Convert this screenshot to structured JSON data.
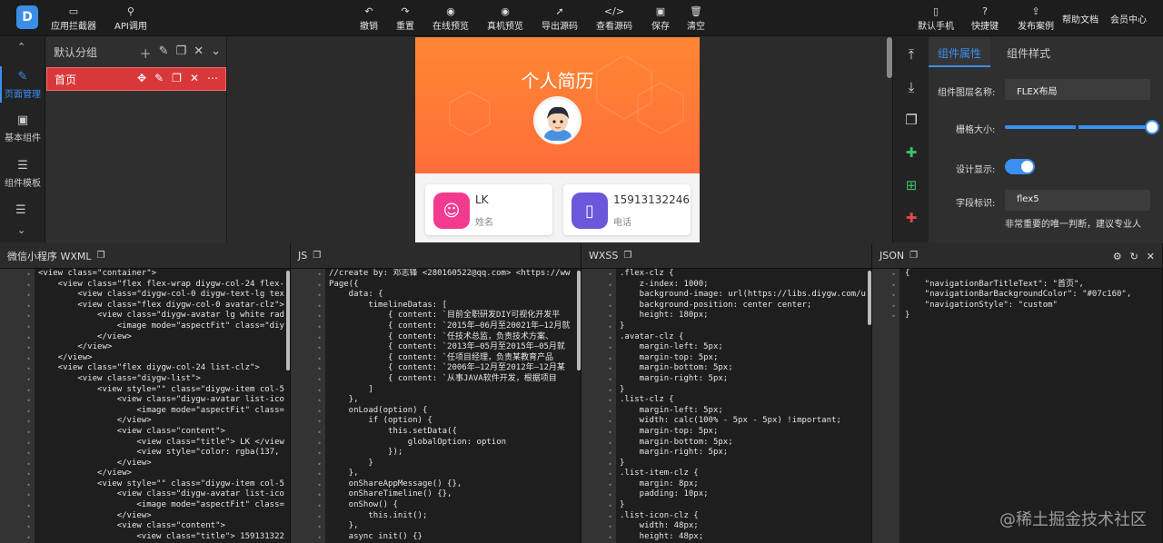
{
  "toolbar": {
    "left": [
      {
        "icon": "app-interceptor-icon",
        "label": "应用拦截器"
      },
      {
        "icon": "api-icon",
        "label": "API调用"
      }
    ],
    "center": [
      {
        "icon": "undo-icon",
        "label": "撤销"
      },
      {
        "icon": "redo-icon",
        "label": "重置"
      },
      {
        "icon": "eye-icon",
        "label": "在线预览"
      },
      {
        "icon": "eye-icon",
        "label": "真机预览"
      },
      {
        "icon": "export-icon",
        "label": "导出源码"
      },
      {
        "icon": "code-icon",
        "label": "查看源码"
      },
      {
        "icon": "save-icon",
        "label": "保存"
      },
      {
        "icon": "trash-icon",
        "label": "清空"
      }
    ],
    "right": [
      {
        "icon": "phone-icon",
        "label": "默认手机"
      },
      {
        "icon": "question-icon",
        "label": "快捷键"
      },
      {
        "icon": "publish-icon",
        "label": "发布案例"
      },
      {
        "icon": "",
        "label": "帮助文档"
      },
      {
        "icon": "",
        "label": "会员中心"
      }
    ]
  },
  "leftnav": [
    {
      "icon": "pen-icon",
      "label": "页面管理",
      "active": true
    },
    {
      "icon": "component-icon",
      "label": "基本组件",
      "active": false
    },
    {
      "icon": "database-icon",
      "label": "组件模板",
      "active": false
    }
  ],
  "pages": {
    "group": "默认分组",
    "items": [
      {
        "label": "首页"
      }
    ]
  },
  "preview": {
    "title": "个人简历",
    "cards": [
      {
        "value": "LK",
        "label": "姓名",
        "color": "#f33a8f"
      },
      {
        "value": "15913132246",
        "label": "电话",
        "color": "#6a57d9"
      }
    ]
  },
  "props": {
    "tabs": [
      "组件属性",
      "组件样式"
    ],
    "layer_name_label": "组件图层名称:",
    "layer_name_value": "FLEX布局",
    "grid_size_label": "栅格大小:",
    "design_show_label": "设计显示:",
    "field_id_label": "字段标识:",
    "field_id_value": "flex5",
    "hint": "非常重要的唯一判断，建议专业人"
  },
  "panels": {
    "wxml": {
      "title": "微信小程序 WXML",
      "lines": [
        "<view class=\"container\">",
        "    <view class=\"flex flex-wrap diygw-col-24 flex-",
        "        <view class=\"diygw-col-0 diygw-text-lg tex",
        "        <view class=\"flex diygw-col-0 avatar-clz\">",
        "            <view class=\"diygw-avatar lg white rad",
        "                <image mode=\"aspectFit\" class=\"diy",
        "            </view>",
        "        </view>",
        "    </view>",
        "    <view class=\"flex diygw-col-24 list-clz\">",
        "        <view class=\"diygw-list\">",
        "            <view style=\"\" class=\"diygw-item col-5",
        "                <view class=\"diygw-avatar list-ico",
        "                    <image mode=\"aspectFit\" class=",
        "                </view>",
        "                <view class=\"content\">",
        "                    <view class=\"title\"> LK </view",
        "                    <view style=\"color: rgba(137,",
        "                </view>",
        "            </view>",
        "            <view style=\"\" class=\"diygw-item col-5",
        "                <view class=\"diygw-avatar list-ico",
        "                    <image mode=\"aspectFit\" class=",
        "                </view>",
        "                <view class=\"content\">",
        "                    <view class=\"title\"> 159131322"
      ]
    },
    "js": {
      "title": "JS",
      "lines": [
        "//create by: 邓志锋 <280160522@qq.com> <https://ww",
        "Page({",
        "    data: {",
        "        timelineDatas: [",
        "            { content: `目前全职研发DIY可视化开发平",
        "            { content: `2015年—06月至20021年—12月就",
        "            { content: `任技术总监，负责技术方案、",
        "            { content: `2013年—05月至2015年—05月就",
        "            { content: `任项目经理，负责某教育产品",
        "            { content: `2006年—12月至2012年—12月某",
        "            { content: `从事JAVA软件开发，根据项目",
        "        ]",
        "    },",
        "    onLoad(option) {",
        "        if (option) {",
        "            this.setData({",
        "                globalOption: option",
        "            });",
        "        }",
        "    },",
        "    onShareAppMessage() {},",
        "    onShareTimeline() {},",
        "    onShow() {",
        "        this.init();",
        "    },",
        "    async init() {}"
      ]
    },
    "wxss": {
      "title": "WXSS",
      "lines": [
        ".flex-clz {",
        "    z-index: 1000;",
        "    background-image: url(https://libs.diygw.com/u",
        "    background-position: center center;",
        "    height: 180px;",
        "}",
        ".avatar-clz {",
        "    margin-left: 5px;",
        "    margin-top: 5px;",
        "    margin-bottom: 5px;",
        "    margin-right: 5px;",
        "}",
        ".list-clz {",
        "    margin-left: 5px;",
        "    width: calc(100% - 5px - 5px) !important;",
        "    margin-top: 5px;",
        "    margin-bottom: 5px;",
        "    margin-right: 5px;",
        "}",
        ".list-item-clz {",
        "    margin: 8px;",
        "    padding: 10px;",
        "}",
        ".list-icon-clz {",
        "    width: 48px;",
        "    height: 48px;"
      ]
    },
    "json": {
      "title": "JSON",
      "lines": [
        "{",
        "    \"navigationBarTitleText\": \"首页\",",
        "    \"navigationBarBackgroundColor\": \"#07c160\",",
        "    \"navigationStyle\": \"custom\"",
        "}"
      ]
    }
  },
  "watermark": "@稀土掘金技术社区"
}
